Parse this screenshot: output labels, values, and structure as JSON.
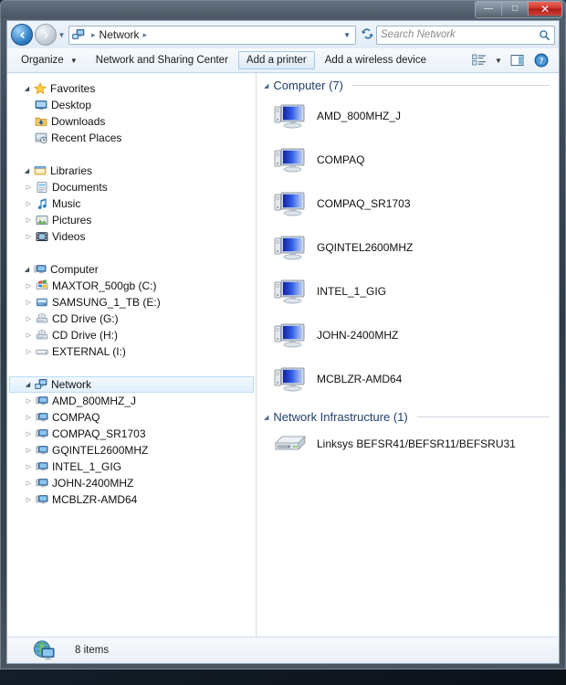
{
  "window": {
    "controls": {
      "minimize": "—",
      "maximize": "□",
      "close": "✕"
    }
  },
  "addressbar": {
    "back_icon": "back-arrow-icon",
    "forward_icon": "forward-arrow-icon",
    "history_caret": "▼",
    "location_icon": "network-icon",
    "crumb": "Network",
    "crumb_sep": "▸",
    "crumb_trailing_sep": "▸",
    "dropdown_caret": "▼",
    "refresh_icon": "refresh-icon"
  },
  "search": {
    "placeholder": "Search Network",
    "icon": "search-icon"
  },
  "toolbar": {
    "organize": "Organize",
    "organize_caret": "▼",
    "network_sharing": "Network and Sharing Center",
    "add_printer": "Add a printer",
    "add_wireless": "Add a wireless device",
    "view_caret": "▼",
    "view_icon": "change-view-icon",
    "preview_icon": "preview-pane-icon",
    "help_icon": "help-icon"
  },
  "sidebar": {
    "groups": [
      {
        "name": "Favorites",
        "icon": "star-icon",
        "expanded": true,
        "items": [
          {
            "label": "Desktop",
            "icon": "desktop-icon"
          },
          {
            "label": "Downloads",
            "icon": "downloads-icon"
          },
          {
            "label": "Recent Places",
            "icon": "recent-places-icon"
          }
        ]
      },
      {
        "name": "Libraries",
        "icon": "libraries-icon",
        "expanded": true,
        "items": [
          {
            "label": "Documents",
            "icon": "documents-icon"
          },
          {
            "label": "Music",
            "icon": "music-icon"
          },
          {
            "label": "Pictures",
            "icon": "pictures-icon"
          },
          {
            "label": "Videos",
            "icon": "videos-icon"
          }
        ]
      },
      {
        "name": "Computer",
        "icon": "computer-icon",
        "expanded": true,
        "items": [
          {
            "label": "MAXTOR_500gb (C:)",
            "icon": "system-drive-icon"
          },
          {
            "label": "SAMSUNG_1_TB (E:)",
            "icon": "hard-drive-icon"
          },
          {
            "label": "CD Drive (G:)",
            "icon": "cd-drive-icon"
          },
          {
            "label": "CD Drive (H:)",
            "icon": "cd-drive-icon"
          },
          {
            "label": "EXTERNAL (I:)",
            "icon": "external-drive-icon"
          }
        ]
      },
      {
        "name": "Network",
        "icon": "network-icon",
        "expanded": true,
        "selected": true,
        "items": [
          {
            "label": "AMD_800MHZ_J",
            "icon": "computer-icon"
          },
          {
            "label": "COMPAQ",
            "icon": "computer-icon"
          },
          {
            "label": "COMPAQ_SR1703",
            "icon": "computer-icon"
          },
          {
            "label": "GQINTEL2600MHZ",
            "icon": "computer-icon"
          },
          {
            "label": "INTEL_1_GIG",
            "icon": "computer-icon"
          },
          {
            "label": "JOHN-2400MHZ",
            "icon": "computer-icon"
          },
          {
            "label": "MCBLZR-AMD64",
            "icon": "computer-icon"
          }
        ]
      }
    ]
  },
  "content": {
    "groups": [
      {
        "header": "Computer (7)",
        "caret": "◢",
        "items": [
          {
            "label": "AMD_800MHZ_J",
            "icon": "computer-icon"
          },
          {
            "label": "COMPAQ",
            "icon": "computer-icon"
          },
          {
            "label": "COMPAQ_SR1703",
            "icon": "computer-icon"
          },
          {
            "label": "GQINTEL2600MHZ",
            "icon": "computer-icon"
          },
          {
            "label": "INTEL_1_GIG",
            "icon": "computer-icon"
          },
          {
            "label": "JOHN-2400MHZ",
            "icon": "computer-icon"
          },
          {
            "label": "MCBLZR-AMD64",
            "icon": "computer-icon"
          }
        ]
      },
      {
        "header": "Network Infrastructure (1)",
        "caret": "◢",
        "items": [
          {
            "label": "Linksys BEFSR41/BEFSR11/BEFSRU31",
            "icon": "router-icon"
          }
        ]
      }
    ]
  },
  "statusbar": {
    "icon": "network-globe-icon",
    "text": "8 items"
  },
  "colors": {
    "accent_blue": "#1f3f6b",
    "selection": "#e2f0fc",
    "selection_border": "#bcdcf4",
    "close_red": "#d0342a"
  }
}
